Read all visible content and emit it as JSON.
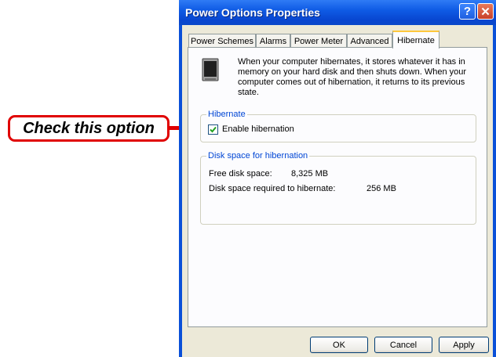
{
  "window": {
    "title": "Power Options Properties",
    "help_label": "?",
    "close_label": "✕"
  },
  "tabs": [
    {
      "label": "Power Schemes"
    },
    {
      "label": "Alarms"
    },
    {
      "label": "Power Meter"
    },
    {
      "label": "Advanced"
    },
    {
      "label": "Hibernate",
      "active": true
    }
  ],
  "hibernate": {
    "description": "When your computer hibernates, it stores whatever it has in memory on your hard disk and then shuts down. When your computer comes out of hibernation, it returns to its previous state.",
    "group_title": "Hibernate",
    "enable_label": "Enable hibernation",
    "enable_checked": true,
    "disk_group_title": "Disk space for hibernation",
    "free_label": "Free disk space:",
    "free_value": "8,325 MB",
    "required_label": "Disk space required to hibernate:",
    "required_value": "256 MB"
  },
  "buttons": {
    "ok": "OK",
    "cancel": "Cancel",
    "apply": "Apply"
  },
  "callout": {
    "text": "Check this option"
  },
  "colors": {
    "callout_red": "#e00000",
    "titlebar_blue": "#0a50d8",
    "group_title_blue": "#0046d5"
  },
  "icons": {
    "hibernate_icon": "computer-hibernate-icon",
    "checkmark": "checkmark-icon"
  }
}
